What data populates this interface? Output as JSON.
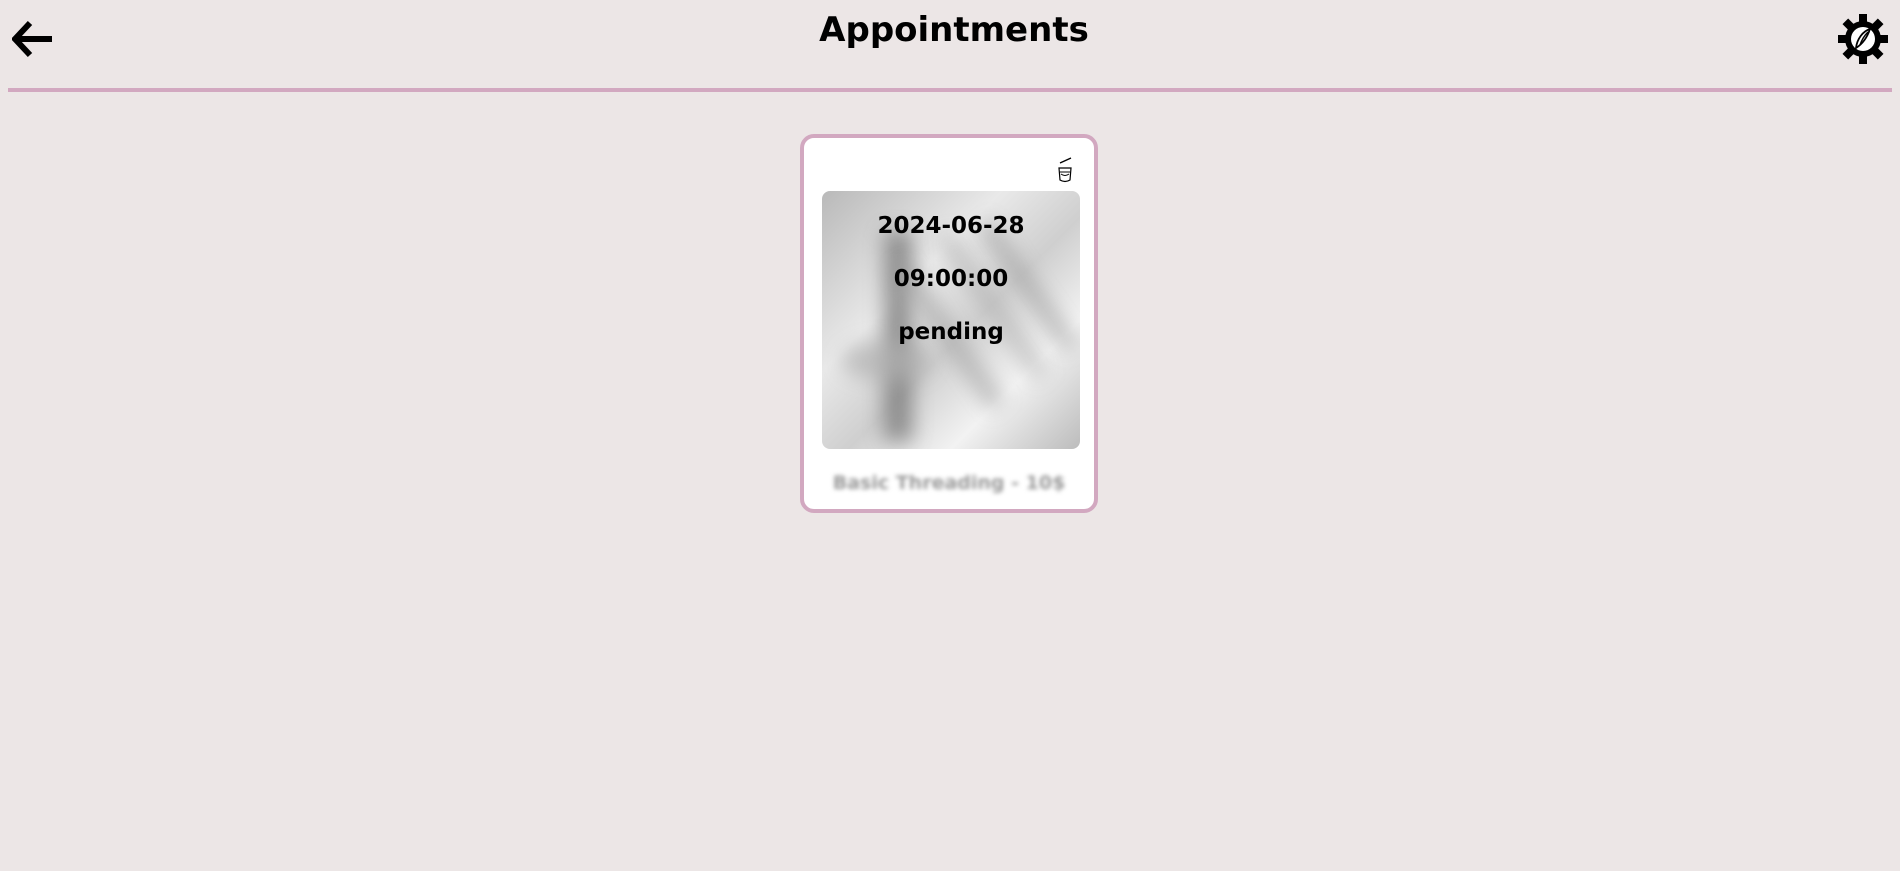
{
  "header": {
    "title": "Appointments",
    "back_icon": "arrow-left-icon",
    "settings_icon": "gear-icon"
  },
  "colors": {
    "background": "#ece6e6",
    "accent": "#d2a8c0",
    "card_background": "#ffffff"
  },
  "appointments": [
    {
      "date": "2024-06-28",
      "time": "09:00:00",
      "status": "pending",
      "service": "Basic Threading - 10$",
      "action_icon": "cancel-icon"
    }
  ]
}
